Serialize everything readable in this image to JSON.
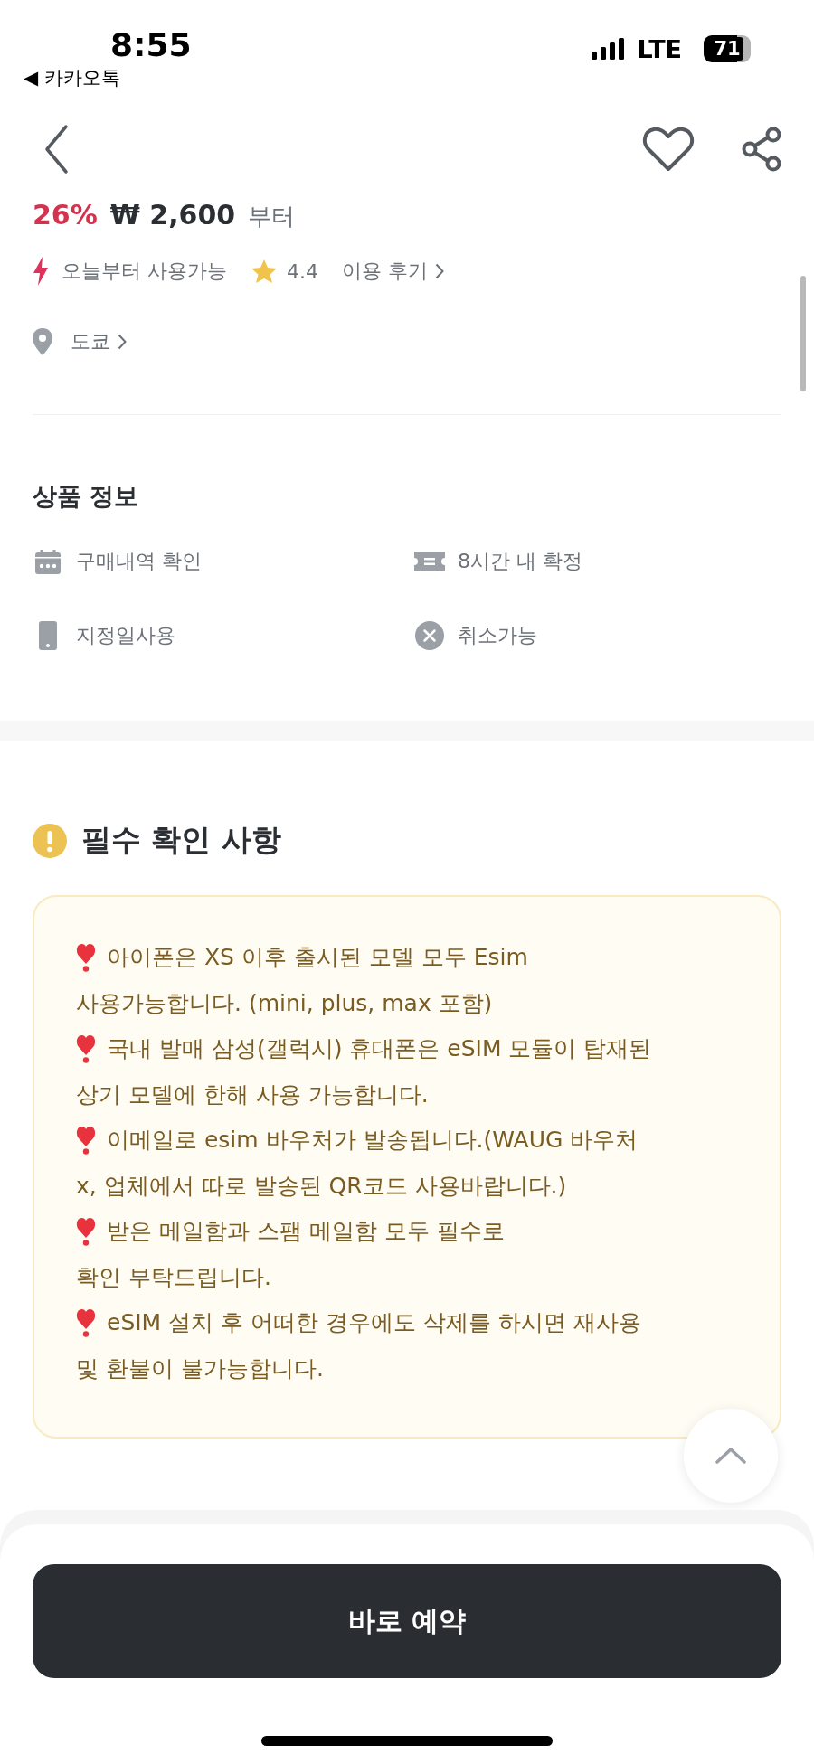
{
  "status_bar": {
    "time": "8:55",
    "back_app": "◀ 카카오톡",
    "network": "LTE",
    "battery": "71"
  },
  "nav": {
    "liked": false
  },
  "price": {
    "discount": "26%",
    "amount": "₩ 2,600",
    "suffix": "부터"
  },
  "highlights": {
    "availability": "오늘부터 사용가능",
    "rating": "4.4",
    "reviews_link": "이용 후기",
    "location": "도쿄"
  },
  "product_info": {
    "title": "상품 정보",
    "items": [
      {
        "kind": "calendar",
        "label": "구매내역 확인"
      },
      {
        "kind": "ticket",
        "label": "8시간 내 확정"
      },
      {
        "kind": "phone",
        "label": "지정일사용"
      },
      {
        "kind": "cancel",
        "label": "취소가능"
      }
    ]
  },
  "notice": {
    "title": "필수 확인 사항",
    "items": [
      {
        "lines": [
          "아이폰은 XS 이후 출시된 모델 모두 Esim",
          "사용가능합니다. (mini, plus, max 포함)"
        ]
      },
      {
        "lines": [
          "국내 발매 삼성(갤럭시) 휴대폰은 eSIM 모듈이 탑재된",
          "상기 모델에 한해 사용 가능합니다."
        ]
      },
      {
        "lines": [
          "이메일로 esim 바우처가 발송됩니다.(WAUG 바우처",
          "x, 업체에서 따로 발송된 QR코드 사용바랍니다.)"
        ]
      },
      {
        "lines": [
          "받은 메일함과 스팸 메일함 모두 필수로",
          "확인 부탁드립니다."
        ]
      },
      {
        "lines": [
          "eSIM 설치 후 어떠한 경우에도 삭제를 하시면 재사용",
          "및 환불이 불가능합니다."
        ]
      }
    ]
  },
  "book_button": "바로 예약"
}
